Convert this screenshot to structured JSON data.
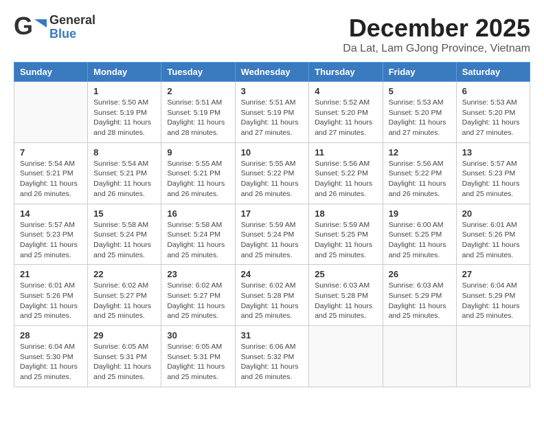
{
  "logo": {
    "general": "General",
    "blue": "Blue"
  },
  "title": "December 2025",
  "location": "Da Lat, Lam GJong Province, Vietnam",
  "headers": [
    "Sunday",
    "Monday",
    "Tuesday",
    "Wednesday",
    "Thursday",
    "Friday",
    "Saturday"
  ],
  "weeks": [
    [
      {
        "day": "",
        "info": ""
      },
      {
        "day": "1",
        "info": "Sunrise: 5:50 AM\nSunset: 5:19 PM\nDaylight: 11 hours\nand 28 minutes."
      },
      {
        "day": "2",
        "info": "Sunrise: 5:51 AM\nSunset: 5:19 PM\nDaylight: 11 hours\nand 28 minutes."
      },
      {
        "day": "3",
        "info": "Sunrise: 5:51 AM\nSunset: 5:19 PM\nDaylight: 11 hours\nand 27 minutes."
      },
      {
        "day": "4",
        "info": "Sunrise: 5:52 AM\nSunset: 5:20 PM\nDaylight: 11 hours\nand 27 minutes."
      },
      {
        "day": "5",
        "info": "Sunrise: 5:53 AM\nSunset: 5:20 PM\nDaylight: 11 hours\nand 27 minutes."
      },
      {
        "day": "6",
        "info": "Sunrise: 5:53 AM\nSunset: 5:20 PM\nDaylight: 11 hours\nand 27 minutes."
      }
    ],
    [
      {
        "day": "7",
        "info": "Sunrise: 5:54 AM\nSunset: 5:21 PM\nDaylight: 11 hours\nand 26 minutes."
      },
      {
        "day": "8",
        "info": "Sunrise: 5:54 AM\nSunset: 5:21 PM\nDaylight: 11 hours\nand 26 minutes."
      },
      {
        "day": "9",
        "info": "Sunrise: 5:55 AM\nSunset: 5:21 PM\nDaylight: 11 hours\nand 26 minutes."
      },
      {
        "day": "10",
        "info": "Sunrise: 5:55 AM\nSunset: 5:22 PM\nDaylight: 11 hours\nand 26 minutes."
      },
      {
        "day": "11",
        "info": "Sunrise: 5:56 AM\nSunset: 5:22 PM\nDaylight: 11 hours\nand 26 minutes."
      },
      {
        "day": "12",
        "info": "Sunrise: 5:56 AM\nSunset: 5:22 PM\nDaylight: 11 hours\nand 26 minutes."
      },
      {
        "day": "13",
        "info": "Sunrise: 5:57 AM\nSunset: 5:23 PM\nDaylight: 11 hours\nand 25 minutes."
      }
    ],
    [
      {
        "day": "14",
        "info": "Sunrise: 5:57 AM\nSunset: 5:23 PM\nDaylight: 11 hours\nand 25 minutes."
      },
      {
        "day": "15",
        "info": "Sunrise: 5:58 AM\nSunset: 5:24 PM\nDaylight: 11 hours\nand 25 minutes."
      },
      {
        "day": "16",
        "info": "Sunrise: 5:58 AM\nSunset: 5:24 PM\nDaylight: 11 hours\nand 25 minutes."
      },
      {
        "day": "17",
        "info": "Sunrise: 5:59 AM\nSunset: 5:24 PM\nDaylight: 11 hours\nand 25 minutes."
      },
      {
        "day": "18",
        "info": "Sunrise: 5:59 AM\nSunset: 5:25 PM\nDaylight: 11 hours\nand 25 minutes."
      },
      {
        "day": "19",
        "info": "Sunrise: 6:00 AM\nSunset: 5:25 PM\nDaylight: 11 hours\nand 25 minutes."
      },
      {
        "day": "20",
        "info": "Sunrise: 6:01 AM\nSunset: 5:26 PM\nDaylight: 11 hours\nand 25 minutes."
      }
    ],
    [
      {
        "day": "21",
        "info": "Sunrise: 6:01 AM\nSunset: 5:26 PM\nDaylight: 11 hours\nand 25 minutes."
      },
      {
        "day": "22",
        "info": "Sunrise: 6:02 AM\nSunset: 5:27 PM\nDaylight: 11 hours\nand 25 minutes."
      },
      {
        "day": "23",
        "info": "Sunrise: 6:02 AM\nSunset: 5:27 PM\nDaylight: 11 hours\nand 25 minutes."
      },
      {
        "day": "24",
        "info": "Sunrise: 6:02 AM\nSunset: 5:28 PM\nDaylight: 11 hours\nand 25 minutes."
      },
      {
        "day": "25",
        "info": "Sunrise: 6:03 AM\nSunset: 5:28 PM\nDaylight: 11 hours\nand 25 minutes."
      },
      {
        "day": "26",
        "info": "Sunrise: 6:03 AM\nSunset: 5:29 PM\nDaylight: 11 hours\nand 25 minutes."
      },
      {
        "day": "27",
        "info": "Sunrise: 6:04 AM\nSunset: 5:29 PM\nDaylight: 11 hours\nand 25 minutes."
      }
    ],
    [
      {
        "day": "28",
        "info": "Sunrise: 6:04 AM\nSunset: 5:30 PM\nDaylight: 11 hours\nand 25 minutes."
      },
      {
        "day": "29",
        "info": "Sunrise: 6:05 AM\nSunset: 5:31 PM\nDaylight: 11 hours\nand 25 minutes."
      },
      {
        "day": "30",
        "info": "Sunrise: 6:05 AM\nSunset: 5:31 PM\nDaylight: 11 hours\nand 25 minutes."
      },
      {
        "day": "31",
        "info": "Sunrise: 6:06 AM\nSunset: 5:32 PM\nDaylight: 11 hours\nand 26 minutes."
      },
      {
        "day": "",
        "info": ""
      },
      {
        "day": "",
        "info": ""
      },
      {
        "day": "",
        "info": ""
      }
    ]
  ]
}
